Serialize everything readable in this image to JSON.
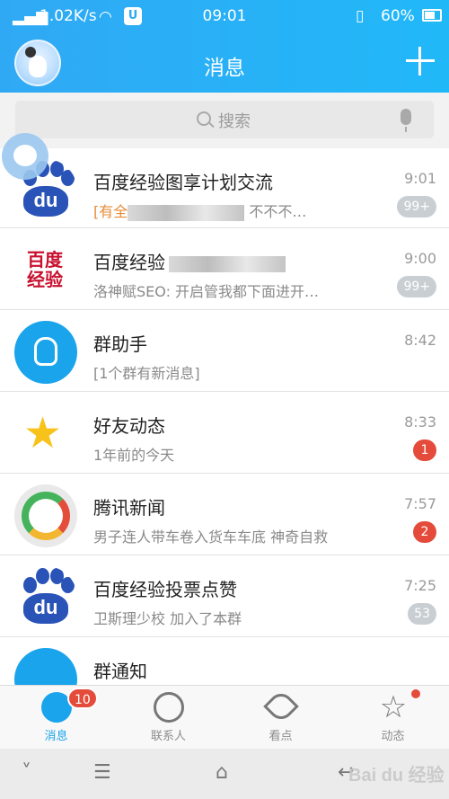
{
  "status_bar": {
    "network_speed": "1.02K/s",
    "time": "09:01",
    "battery": "60%"
  },
  "header": {
    "title": "消息"
  },
  "search": {
    "placeholder": "搜索"
  },
  "conversations": [
    {
      "name": "百度经验图享计划交流",
      "preview_tag": "[有全",
      "preview": "不不不…",
      "time": "9:01",
      "badge": "99+",
      "badge_style": "gray",
      "icon": "baidu-logo-icon"
    },
    {
      "name": "百度经验",
      "preview": "洛神赋SEO: 开启管我都下面进开…",
      "time": "9:00",
      "badge": "99+",
      "badge_style": "gray",
      "icon": "baidu-jingyan-logo-icon"
    },
    {
      "name": "群助手",
      "preview": "[1个群有新消息]",
      "time": "8:42",
      "icon": "group-assistant-icon"
    },
    {
      "name": "好友动态",
      "preview": "1年前的今天",
      "time": "8:33",
      "badge": "1",
      "badge_style": "red",
      "icon": "qzone-star-icon"
    },
    {
      "name": "腾讯新闻",
      "preview": "男子连人带车卷入货车车底 神奇自救",
      "time": "7:57",
      "badge": "2",
      "badge_style": "red",
      "icon": "tencent-news-icon"
    },
    {
      "name": "百度经验投票点赞",
      "preview": "卫斯理少校 加入了本群",
      "time": "7:25",
      "badge": "53",
      "badge_style": "gray",
      "icon": "baidu-logo-icon"
    },
    {
      "name": "群通知",
      "icon": "group-notice-icon"
    }
  ],
  "baidu_logo_text": "du",
  "jingyan_logo_text": "百度\n经验",
  "tabs": [
    {
      "label": "消息",
      "badge": "10",
      "icon": "message-bubble-icon",
      "active": true
    },
    {
      "label": "联系人",
      "icon": "contacts-person-icon"
    },
    {
      "label": "看点",
      "icon": "eye-icon"
    },
    {
      "label": "动态",
      "icon": "star-icon"
    }
  ],
  "watermark": "Bai du 经验",
  "colors": {
    "header": "#30a9f4",
    "accent": "#1aa4ec",
    "badge_red": "#e44b3a",
    "badge_gray": "#c9ced3"
  }
}
